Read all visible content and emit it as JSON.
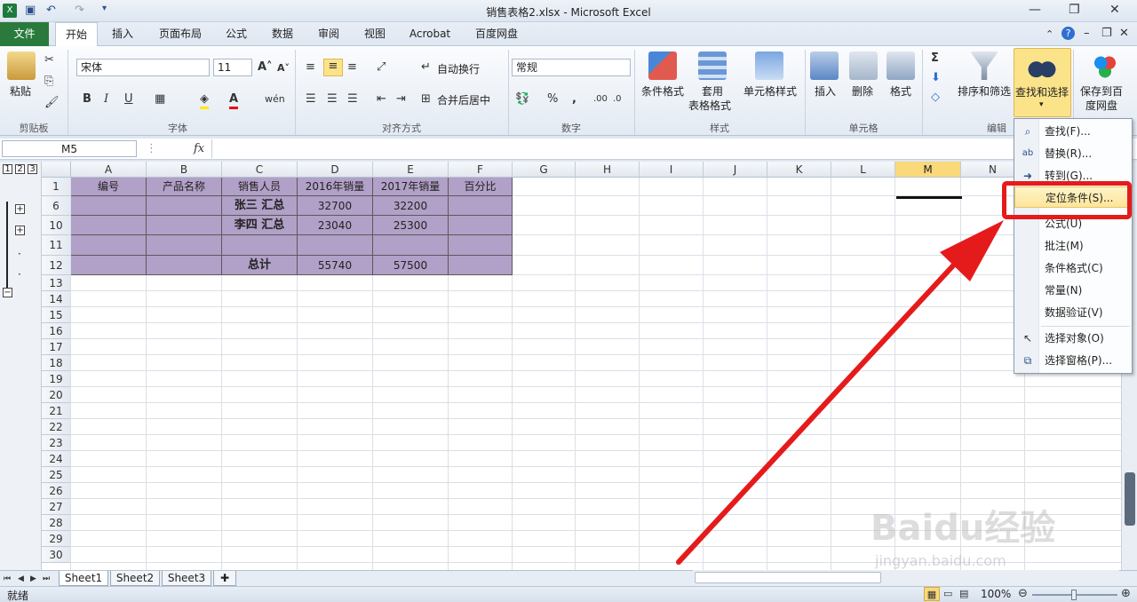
{
  "window": {
    "title": "销售表格2.xlsx - Microsoft Excel"
  },
  "tabs": [
    "文件",
    "开始",
    "插入",
    "页面布局",
    "公式",
    "数据",
    "审阅",
    "视图",
    "Acrobat",
    "百度网盘"
  ],
  "ribbon": {
    "clipboard": {
      "paste": "粘贴",
      "label": "剪贴板"
    },
    "font": {
      "name": "宋体",
      "size": "11",
      "label": "字体",
      "bold": "B",
      "italic": "I",
      "underline": "U"
    },
    "alignment": {
      "wrap": "自动换行",
      "merge": "合并后居中",
      "label": "对齐方式"
    },
    "number": {
      "format": "常规",
      "percent": "%",
      "comma": ",",
      "label": "数字"
    },
    "styles": {
      "cond_format": "条件格式",
      "table_format_1": "套用",
      "table_format_2": "表格格式",
      "cell_styles": "单元格样式",
      "label": "样式"
    },
    "cells": {
      "insert": "插入",
      "delete": "删除",
      "format": "格式",
      "label": "单元格"
    },
    "editing": {
      "sigma": "Σ",
      "sort_filter": "排序和筛选",
      "find_select": "查找和选择",
      "label": "编辑"
    },
    "baidu": {
      "save_1": "保存到百",
      "save_2": "度网盘"
    }
  },
  "formula_bar": {
    "name_box": "M5",
    "fx": "fx",
    "value": ""
  },
  "columns": [
    "A",
    "B",
    "C",
    "D",
    "E",
    "F",
    "G",
    "H",
    "I",
    "J",
    "K",
    "L",
    "M",
    "N"
  ],
  "selected_column": "M",
  "rows": [
    "1",
    "6",
    "10",
    "11",
    "12",
    "13",
    "14",
    "15",
    "16",
    "17",
    "18",
    "19",
    "20",
    "21",
    "22",
    "23",
    "24",
    "25",
    "26",
    "27",
    "28",
    "29",
    "30"
  ],
  "outline_levels": [
    "1",
    "2",
    "3"
  ],
  "table": {
    "headers": [
      "编号",
      "产品名称",
      "销售人员",
      "2016年销量",
      "2017年销量",
      "百分比"
    ],
    "body": [
      [
        "",
        "",
        "张三 汇总",
        "32700",
        "32200",
        ""
      ],
      [
        "",
        "",
        "李四 汇总",
        "23040",
        "25300",
        ""
      ],
      [
        "",
        "",
        "",
        "",
        "",
        ""
      ],
      [
        "",
        "",
        "总计",
        "55740",
        "57500",
        ""
      ]
    ]
  },
  "menu": {
    "items": [
      {
        "label": "查找(F)...",
        "icon": "binoculars-icon"
      },
      {
        "label": "替换(R)...",
        "icon": "replace-icon"
      },
      {
        "label": "转到(G)...",
        "icon": "arrow-right-icon"
      },
      {
        "label": "定位条件(S)...",
        "icon": ""
      },
      {
        "label": "公式(U)",
        "icon": ""
      },
      {
        "label": "批注(M)",
        "icon": ""
      },
      {
        "label": "条件格式(C)",
        "icon": ""
      },
      {
        "label": "常量(N)",
        "icon": ""
      },
      {
        "label": "数据验证(V)",
        "icon": ""
      },
      {
        "label": "选择对象(O)",
        "icon": "cursor-icon"
      },
      {
        "label": "选择窗格(P)...",
        "icon": "selection-pane-icon"
      }
    ],
    "highlighted_index": 3
  },
  "sheets": [
    "Sheet1",
    "Sheet2",
    "Sheet3"
  ],
  "status": {
    "ready": "就绪",
    "zoom": "100%"
  },
  "watermark": {
    "brand": "Baidu经验",
    "url": "jingyan.baidu.com"
  },
  "colors": {
    "table_fill": "#b1a0c7",
    "file_tab": "#2b7a3d",
    "highlight": "#e51b1b",
    "arrow": "#e51b1b"
  }
}
